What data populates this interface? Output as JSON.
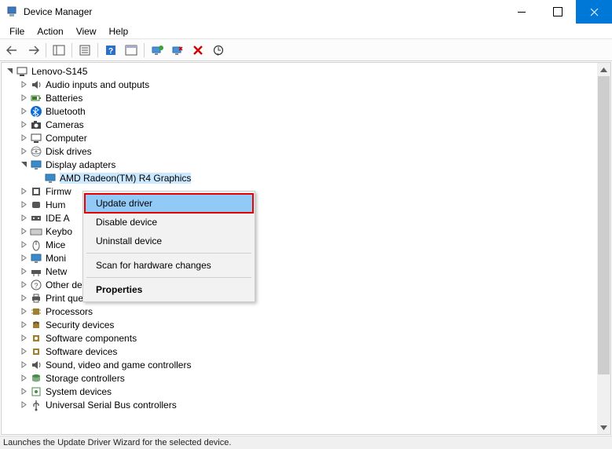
{
  "window": {
    "title": "Device Manager"
  },
  "menu": {
    "items": [
      "File",
      "Action",
      "View",
      "Help"
    ]
  },
  "tree": {
    "root": {
      "label": "Lenovo-S145"
    },
    "categories": [
      {
        "label": "Audio inputs and outputs",
        "icon": "speaker"
      },
      {
        "label": "Batteries",
        "icon": "battery"
      },
      {
        "label": "Bluetooth",
        "icon": "bluetooth"
      },
      {
        "label": "Cameras",
        "icon": "camera"
      },
      {
        "label": "Computer",
        "icon": "computer"
      },
      {
        "label": "Disk drives",
        "icon": "disk"
      },
      {
        "label": "Display adapters",
        "icon": "monitor",
        "expanded": true,
        "children": [
          {
            "label": "AMD Radeon(TM) R4 Graphics",
            "icon": "monitor",
            "selected": true
          }
        ]
      },
      {
        "label": "Firmware",
        "icon": "firmware",
        "truncLabel": "Firmw"
      },
      {
        "label": "Human Interface Devices",
        "icon": "hid",
        "truncLabel": "Hum"
      },
      {
        "label": "IDE ATA/ATAPI controllers",
        "icon": "ide",
        "truncLabel": "IDE A"
      },
      {
        "label": "Keyboards",
        "icon": "keyboard",
        "truncLabel": "Keybo"
      },
      {
        "label": "Mice and other pointing devices",
        "icon": "mouse",
        "truncLabel": "Mice"
      },
      {
        "label": "Monitors",
        "icon": "monitor",
        "truncLabel": "Moni"
      },
      {
        "label": "Network adapters",
        "icon": "network",
        "truncLabel": "Netw"
      },
      {
        "label": "Other devices",
        "icon": "other"
      },
      {
        "label": "Print queues",
        "icon": "printer"
      },
      {
        "label": "Processors",
        "icon": "cpu"
      },
      {
        "label": "Security devices",
        "icon": "security"
      },
      {
        "label": "Software components",
        "icon": "swcomp"
      },
      {
        "label": "Software devices",
        "icon": "swdev"
      },
      {
        "label": "Sound, video and game controllers",
        "icon": "speaker"
      },
      {
        "label": "Storage controllers",
        "icon": "storage"
      },
      {
        "label": "System devices",
        "icon": "system"
      },
      {
        "label": "Universal Serial Bus controllers",
        "icon": "usb"
      }
    ]
  },
  "context_menu": {
    "items": [
      {
        "label": "Update driver",
        "highlighted": true,
        "outlined": true
      },
      {
        "label": "Disable device"
      },
      {
        "label": "Uninstall device"
      },
      {
        "sep": true
      },
      {
        "label": "Scan for hardware changes"
      },
      {
        "sep": true
      },
      {
        "label": "Properties",
        "bold": true
      }
    ]
  },
  "statusbar": {
    "text": "Launches the Update Driver Wizard for the selected device."
  }
}
